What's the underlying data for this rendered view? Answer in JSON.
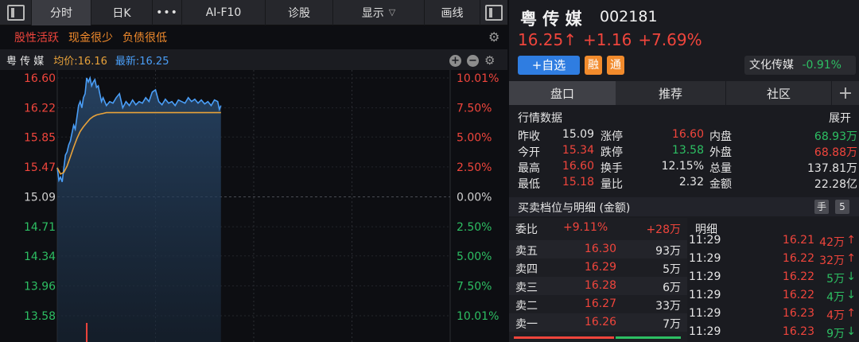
{
  "toolbar": {
    "tabs": [
      "分时",
      "日K",
      "AI-F10",
      "诊股"
    ],
    "more": "•••",
    "display_label": "显示",
    "draw_label": "画线"
  },
  "tags": [
    "股性活跃",
    "现金很少",
    "负债很低"
  ],
  "chart_header": {
    "name": "粤 传 媒",
    "avg_label": "均价:16.16",
    "latest_label": "最新:16.25"
  },
  "chart_data": {
    "type": "line",
    "price_labels": [
      "16.60",
      "16.22",
      "15.85",
      "15.47",
      "15.09",
      "14.71",
      "14.34",
      "13.96",
      "13.58"
    ],
    "pct_labels": [
      "10.01%",
      "7.50%",
      "5.00%",
      "2.50%",
      "0.00%",
      "2.50%",
      "5.00%",
      "7.50%",
      "10.01%"
    ],
    "ylim": [
      13.58,
      16.6
    ],
    "prev_close": 15.09,
    "x_max": 240,
    "series": [
      {
        "x": [
          0,
          1,
          2,
          3,
          4,
          5,
          6,
          7,
          8,
          9,
          10,
          11,
          12,
          13,
          14,
          15,
          16,
          17,
          18,
          19,
          20,
          21,
          22,
          23,
          24,
          25,
          26,
          27,
          28,
          30,
          32,
          34,
          36,
          38,
          40,
          42,
          44,
          46,
          48,
          50,
          52,
          54,
          56,
          58,
          60,
          62,
          64,
          66,
          68,
          70,
          72,
          74,
          76,
          78,
          80,
          82,
          84,
          86,
          88,
          90,
          92,
          94,
          96,
          98,
          99,
          100
        ],
        "values": [
          15.46,
          15.3,
          15.34,
          15.28,
          15.45,
          15.62,
          15.66,
          15.75,
          15.8,
          15.9,
          16.0,
          15.95,
          16.1,
          16.25,
          16.3,
          16.22,
          16.35,
          16.4,
          16.6,
          16.55,
          16.6,
          16.5,
          16.55,
          16.58,
          16.48,
          16.5,
          16.4,
          16.3,
          16.35,
          16.25,
          16.3,
          16.28,
          16.35,
          16.4,
          16.22,
          16.3,
          16.25,
          16.32,
          16.26,
          16.3,
          16.28,
          16.35,
          16.3,
          16.42,
          16.45,
          16.3,
          16.26,
          16.33,
          16.28,
          16.3,
          16.25,
          16.32,
          16.3,
          16.28,
          16.35,
          16.3,
          16.33,
          16.28,
          16.32,
          16.27,
          16.3,
          16.25,
          16.32,
          16.3,
          16.2,
          16.25
        ]
      },
      {
        "x": [
          0,
          2,
          4,
          6,
          8,
          10,
          12,
          14,
          16,
          18,
          20,
          22,
          24,
          26,
          28,
          30,
          34,
          38,
          42,
          46,
          50,
          60,
          70,
          80,
          90,
          100
        ],
        "values": [
          15.46,
          15.38,
          15.4,
          15.48,
          15.6,
          15.72,
          15.83,
          15.92,
          15.98,
          16.03,
          16.08,
          16.11,
          16.13,
          16.14,
          16.15,
          16.16,
          16.16,
          16.16,
          16.16,
          16.16,
          16.16,
          16.16,
          16.16,
          16.16,
          16.16,
          16.16
        ]
      }
    ]
  },
  "stock": {
    "name": "粤 传 媒",
    "code": "002181",
    "price": "16.25",
    "arrow": "↑",
    "change": "+1.16",
    "pct": "+7.69%",
    "add_watch": "+自选",
    "badge1": "融",
    "badge2": "通",
    "sector": "文化传媒",
    "sector_pct": "-0.91%"
  },
  "tabs": [
    "盘口",
    "推荐",
    "社区"
  ],
  "tab_plus": "+",
  "quotes": {
    "title": "行情数据",
    "expand": "展开",
    "rows": [
      [
        "昨收",
        "15.09",
        "涨停",
        "16.60",
        "内盘",
        "68.93万"
      ],
      [
        "今开",
        "15.34",
        "跌停",
        "13.58",
        "外盘",
        "68.88万"
      ],
      [
        "最高",
        "16.60",
        "换手",
        "12.15%",
        "总量",
        "137.81万"
      ],
      [
        "最低",
        "15.18",
        "量比",
        "2.32",
        "金额",
        "22.28亿"
      ]
    ]
  },
  "orderbook": {
    "title": "买卖档位与明细 (金额)",
    "hand": "手",
    "level": "5",
    "ratio_label": "委比",
    "ratio_value": "+9.11%",
    "ratio_amount": "+28万",
    "asks": [
      [
        "卖五",
        "16.30",
        "93万"
      ],
      [
        "卖四",
        "16.29",
        "5万"
      ],
      [
        "卖三",
        "16.28",
        "6万"
      ],
      [
        "卖二",
        "16.27",
        "33万"
      ],
      [
        "卖一",
        "16.26",
        "7万"
      ]
    ],
    "detail_label": "明细",
    "trades": [
      [
        "11:29",
        "16.21",
        "42万",
        "↑"
      ],
      [
        "11:29",
        "16.22",
        "32万",
        "↑"
      ],
      [
        "11:29",
        "16.22",
        "5万",
        "↓"
      ],
      [
        "11:29",
        "16.22",
        "4万",
        "↓"
      ],
      [
        "11:29",
        "16.23",
        "4万",
        "↑"
      ],
      [
        "11:29",
        "16.23",
        "9万",
        "↓"
      ]
    ]
  },
  "colors": {
    "red": "#f0453c",
    "green": "#2dbf63",
    "price_line": "#4a9ef7",
    "avg_line": "#e8a23a",
    "orange": "#f28b2c"
  }
}
